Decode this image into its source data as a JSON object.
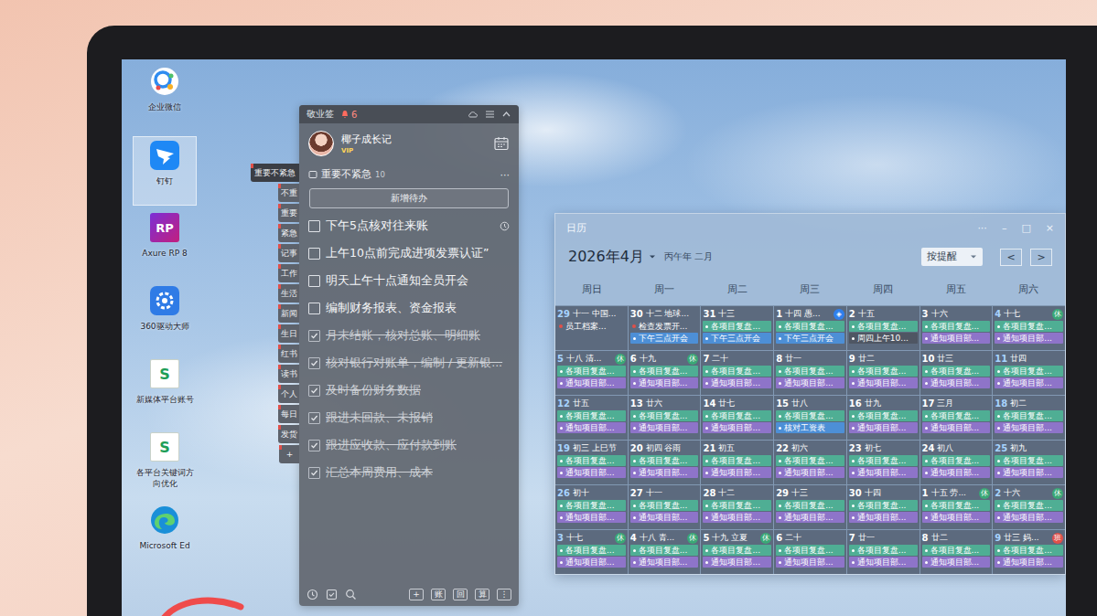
{
  "desktop": {
    "icons": [
      {
        "label": "企业微信",
        "kind": "wecom",
        "selected": false
      },
      {
        "label": "钉钉",
        "kind": "dingtalk",
        "selected": true
      },
      {
        "label": "Axure RP 8",
        "kind": "axure",
        "glyph": "RP",
        "selected": false
      },
      {
        "label": "360驱动大师",
        "kind": "driver",
        "selected": false
      },
      {
        "label": "新媒体平台账号",
        "kind": "sheet",
        "glyph": "S",
        "selected": false
      },
      {
        "label": "各平台关键词方向优化",
        "kind": "sheet",
        "glyph": "S",
        "selected": false
      },
      {
        "label": "Microsoft Ed",
        "kind": "edge",
        "selected": false
      }
    ]
  },
  "notes_app": {
    "title": "敬业签",
    "alert_count": "6",
    "user": {
      "name": "椰子成长记",
      "badge": "VIP"
    },
    "category": {
      "name": "重要不紧急",
      "count": "10",
      "more": "···"
    },
    "add_button": "新增待办",
    "todos": [
      {
        "text": "下午5点核对往来账",
        "checked": false,
        "reminder": true
      },
      {
        "text": "上午10点前完成进项发票认证”",
        "checked": false,
        "reminder": false
      },
      {
        "text": "明天上午十点通知全员开会",
        "checked": false,
        "reminder": false
      },
      {
        "text": "编制财务报表、资金报表",
        "checked": false,
        "reminder": false
      },
      {
        "text": "月末结账，核对总账、明细账",
        "checked": true,
        "reminder": false
      },
      {
        "text": "核对银行对账单，编制 / 更新银...",
        "checked": true,
        "reminder": false
      },
      {
        "text": "及时备份财务数据",
        "checked": true,
        "reminder": false
      },
      {
        "text": "跟进未回款、未报销",
        "checked": true,
        "reminder": false
      },
      {
        "text": "跟进应收款、应付款到账",
        "checked": true,
        "reminder": false
      },
      {
        "text": "汇总本周费用、成本",
        "checked": true,
        "reminder": false
      }
    ],
    "toolbar": [
      "+",
      "账",
      "回",
      "算",
      "⋮"
    ],
    "side_tabs": [
      {
        "label": "重要不紧急",
        "selected": true
      },
      {
        "label": "不重",
        "selected": false
      },
      {
        "label": "重要",
        "selected": false
      },
      {
        "label": "紧急",
        "selected": false
      },
      {
        "label": "记事",
        "selected": false
      },
      {
        "label": "工作",
        "selected": false
      },
      {
        "label": "生活",
        "selected": false
      },
      {
        "label": "新闻",
        "selected": false
      },
      {
        "label": "生日",
        "selected": false
      },
      {
        "label": "红书",
        "selected": false
      },
      {
        "label": "读书",
        "selected": false
      },
      {
        "label": "个人",
        "selected": false
      },
      {
        "label": "每日",
        "selected": false
      },
      {
        "label": "发货",
        "selected": false
      },
      {
        "label": "+",
        "selected": false
      }
    ]
  },
  "calendar": {
    "title": "日历",
    "controls": [
      "···",
      "–",
      "□",
      "×"
    ],
    "month": "2026年4月",
    "lunar_year": "丙午年 二月",
    "filter": "按提醒",
    "prev": "<",
    "next": ">",
    "weekdays": [
      "周日",
      "周一",
      "周二",
      "周三",
      "周四",
      "周五",
      "周六"
    ],
    "weeks": [
      [
        {
          "day": "29",
          "lunar": "十一 中国...",
          "events": [
            {
              "text": "员工档案...",
              "color": "#e0504a",
              "kind": "dot"
            }
          ]
        },
        {
          "day": "30",
          "lunar": "十二 地球...",
          "events": [
            {
              "text": "检查发票开...",
              "color": "#e0504a",
              "kind": "dot"
            },
            {
              "text": "下午三点开会",
              "color": "#4d8fd6",
              "kind": "bar"
            }
          ]
        },
        {
          "day": "31",
          "lunar": "十三",
          "events": [
            {
              "text": "各项目复盘...",
              "color": "#4fae94",
              "kind": "bar"
            },
            {
              "text": "下午三点开会",
              "color": "#4d8fd6",
              "kind": "bar"
            }
          ]
        },
        {
          "day": "1",
          "lunar": "十四 愚...",
          "badge": "◈",
          "badge_color": "#2f80ed",
          "events": [
            {
              "text": "各项目复盘...",
              "color": "#4fae94",
              "kind": "bar"
            },
            {
              "text": "下午三点开会",
              "color": "#4d8fd6",
              "kind": "bar"
            }
          ]
        },
        {
          "day": "2",
          "lunar": "十五",
          "events": [
            {
              "text": "各项目复盘...",
              "color": "#4fae94",
              "kind": "bar"
            },
            {
              "text": "周四上午10...",
              "color": "#4f5663",
              "kind": "bar"
            }
          ]
        },
        {
          "day": "3",
          "lunar": "十六",
          "events": [
            {
              "text": "各项目复盘...",
              "color": "#4fae94",
              "kind": "bar"
            },
            {
              "text": "通知项目部...",
              "color": "#8e74c9",
              "kind": "bar"
            }
          ]
        },
        {
          "day": "4",
          "lunar": "十七",
          "badge": "休",
          "badge_color": "#3aa876",
          "events": [
            {
              "text": "各项目复盘...",
              "color": "#4fae94",
              "kind": "bar"
            },
            {
              "text": "通知项目部...",
              "color": "#8e74c9",
              "kind": "bar"
            }
          ]
        }
      ],
      [
        {
          "day": "5",
          "lunar": "十八 清...",
          "badge": "休",
          "badge_color": "#3aa876",
          "events": [
            {
              "text": "各项目复盘...",
              "color": "#4fae94",
              "kind": "bar"
            },
            {
              "text": "通知项目部...",
              "color": "#8e74c9",
              "kind": "bar"
            }
          ]
        },
        {
          "day": "6",
          "lunar": "十九",
          "badge": "休",
          "badge_color": "#3aa876",
          "events": [
            {
              "text": "各项目复盘...",
              "color": "#4fae94",
              "kind": "bar"
            },
            {
              "text": "通知项目部...",
              "color": "#8e74c9",
              "kind": "bar"
            }
          ]
        },
        {
          "day": "7",
          "lunar": "二十",
          "events": [
            {
              "text": "各项目复盘...",
              "color": "#4fae94",
              "kind": "bar"
            },
            {
              "text": "通知项目部...",
              "color": "#8e74c9",
              "kind": "bar"
            }
          ]
        },
        {
          "day": "8",
          "lunar": "廿一",
          "events": [
            {
              "text": "各项目复盘...",
              "color": "#4fae94",
              "kind": "bar"
            },
            {
              "text": "通知项目部...",
              "color": "#8e74c9",
              "kind": "bar"
            }
          ]
        },
        {
          "day": "9",
          "lunar": "廿二",
          "events": [
            {
              "text": "各项目复盘...",
              "color": "#4fae94",
              "kind": "bar"
            },
            {
              "text": "通知项目部...",
              "color": "#8e74c9",
              "kind": "bar"
            }
          ]
        },
        {
          "day": "10",
          "lunar": "廿三",
          "events": [
            {
              "text": "各项目复盘...",
              "color": "#4fae94",
              "kind": "bar"
            },
            {
              "text": "通知项目部...",
              "color": "#8e74c9",
              "kind": "bar"
            }
          ]
        },
        {
          "day": "11",
          "lunar": "廿四",
          "events": [
            {
              "text": "各项目复盘...",
              "color": "#4fae94",
              "kind": "bar"
            },
            {
              "text": "通知项目部...",
              "color": "#8e74c9",
              "kind": "bar"
            }
          ]
        }
      ],
      [
        {
          "day": "12",
          "lunar": "廿五",
          "events": [
            {
              "text": "各项目复盘...",
              "color": "#4fae94",
              "kind": "bar"
            },
            {
              "text": "通知项目部...",
              "color": "#8e74c9",
              "kind": "bar"
            }
          ]
        },
        {
          "day": "13",
          "lunar": "廿六",
          "events": [
            {
              "text": "各项目复盘...",
              "color": "#4fae94",
              "kind": "bar"
            },
            {
              "text": "通知项目部...",
              "color": "#8e74c9",
              "kind": "bar"
            }
          ]
        },
        {
          "day": "14",
          "lunar": "廿七",
          "events": [
            {
              "text": "各项目复盘...",
              "color": "#4fae94",
              "kind": "bar"
            },
            {
              "text": "通知项目部...",
              "color": "#8e74c9",
              "kind": "bar"
            }
          ]
        },
        {
          "day": "15",
          "lunar": "廿八",
          "events": [
            {
              "text": "各项目复盘...",
              "color": "#4fae94",
              "kind": "bar"
            },
            {
              "text": "核对工资表",
              "color": "#4d8fd6",
              "kind": "bar"
            }
          ]
        },
        {
          "day": "16",
          "lunar": "廿九",
          "events": [
            {
              "text": "各项目复盘...",
              "color": "#4fae94",
              "kind": "bar"
            },
            {
              "text": "通知项目部...",
              "color": "#8e74c9",
              "kind": "bar"
            }
          ]
        },
        {
          "day": "17",
          "lunar": "三月",
          "events": [
            {
              "text": "各项目复盘...",
              "color": "#4fae94",
              "kind": "bar"
            },
            {
              "text": "通知项目部...",
              "color": "#8e74c9",
              "kind": "bar"
            }
          ]
        },
        {
          "day": "18",
          "lunar": "初二",
          "events": [
            {
              "text": "各项目复盘...",
              "color": "#4fae94",
              "kind": "bar"
            },
            {
              "text": "通知项目部...",
              "color": "#8e74c9",
              "kind": "bar"
            }
          ]
        }
      ],
      [
        {
          "day": "19",
          "lunar": "初三 上巳节",
          "events": [
            {
              "text": "各项目复盘...",
              "color": "#4fae94",
              "kind": "bar"
            },
            {
              "text": "通知项目部...",
              "color": "#8e74c9",
              "kind": "bar"
            }
          ]
        },
        {
          "day": "20",
          "lunar": "初四 谷雨",
          "events": [
            {
              "text": "各项目复盘...",
              "color": "#4fae94",
              "kind": "bar"
            },
            {
              "text": "通知项目部...",
              "color": "#8e74c9",
              "kind": "bar"
            }
          ]
        },
        {
          "day": "21",
          "lunar": "初五",
          "events": [
            {
              "text": "各项目复盘...",
              "color": "#4fae94",
              "kind": "bar"
            },
            {
              "text": "通知项目部...",
              "color": "#8e74c9",
              "kind": "bar"
            }
          ]
        },
        {
          "day": "22",
          "lunar": "初六",
          "events": [
            {
              "text": "各项目复盘...",
              "color": "#4fae94",
              "kind": "bar"
            },
            {
              "text": "通知项目部...",
              "color": "#8e74c9",
              "kind": "bar"
            }
          ]
        },
        {
          "day": "23",
          "lunar": "初七",
          "events": [
            {
              "text": "各项目复盘...",
              "color": "#4fae94",
              "kind": "bar"
            },
            {
              "text": "通知项目部...",
              "color": "#8e74c9",
              "kind": "bar"
            }
          ]
        },
        {
          "day": "24",
          "lunar": "初八",
          "events": [
            {
              "text": "各项目复盘...",
              "color": "#4fae94",
              "kind": "bar"
            },
            {
              "text": "通知项目部...",
              "color": "#8e74c9",
              "kind": "bar"
            }
          ]
        },
        {
          "day": "25",
          "lunar": "初九",
          "events": [
            {
              "text": "各项目复盘...",
              "color": "#4fae94",
              "kind": "bar"
            },
            {
              "text": "通知项目部...",
              "color": "#8e74c9",
              "kind": "bar"
            }
          ]
        }
      ],
      [
        {
          "day": "26",
          "lunar": "初十",
          "events": [
            {
              "text": "各项目复盘...",
              "color": "#4fae94",
              "kind": "bar"
            },
            {
              "text": "通知项目部...",
              "color": "#8e74c9",
              "kind": "bar"
            }
          ]
        },
        {
          "day": "27",
          "lunar": "十一",
          "events": [
            {
              "text": "各项目复盘...",
              "color": "#4fae94",
              "kind": "bar"
            },
            {
              "text": "通知项目部...",
              "color": "#8e74c9",
              "kind": "bar"
            }
          ]
        },
        {
          "day": "28",
          "lunar": "十二",
          "events": [
            {
              "text": "各项目复盘...",
              "color": "#4fae94",
              "kind": "bar"
            },
            {
              "text": "通知项目部...",
              "color": "#8e74c9",
              "kind": "bar"
            }
          ]
        },
        {
          "day": "29",
          "lunar": "十三",
          "events": [
            {
              "text": "各项目复盘...",
              "color": "#4fae94",
              "kind": "bar"
            },
            {
              "text": "通知项目部...",
              "color": "#8e74c9",
              "kind": "bar"
            }
          ]
        },
        {
          "day": "30",
          "lunar": "十四",
          "events": [
            {
              "text": "各项目复盘...",
              "color": "#4fae94",
              "kind": "bar"
            },
            {
              "text": "通知项目部...",
              "color": "#8e74c9",
              "kind": "bar"
            }
          ]
        },
        {
          "day": "1",
          "lunar": "十五 劳...",
          "badge": "休",
          "badge_color": "#3aa876",
          "events": [
            {
              "text": "各项目复盘...",
              "color": "#4fae94",
              "kind": "bar"
            },
            {
              "text": "通知项目部...",
              "color": "#8e74c9",
              "kind": "bar"
            }
          ]
        },
        {
          "day": "2",
          "lunar": "十六",
          "badge": "休",
          "badge_color": "#3aa876",
          "events": [
            {
              "text": "各项目复盘...",
              "color": "#4fae94",
              "kind": "bar"
            },
            {
              "text": "通知项目部...",
              "color": "#8e74c9",
              "kind": "bar"
            }
          ]
        }
      ],
      [
        {
          "day": "3",
          "lunar": "十七",
          "badge": "休",
          "badge_color": "#3aa876",
          "events": [
            {
              "text": "各项目复盘...",
              "color": "#4fae94",
              "kind": "bar"
            },
            {
              "text": "通知项目部...",
              "color": "#8e74c9",
              "kind": "bar"
            }
          ]
        },
        {
          "day": "4",
          "lunar": "十八 青...",
          "badge": "休",
          "badge_color": "#3aa876",
          "events": [
            {
              "text": "各项目复盘...",
              "color": "#4fae94",
              "kind": "bar"
            },
            {
              "text": "通知项目部...",
              "color": "#8e74c9",
              "kind": "bar"
            }
          ]
        },
        {
          "day": "5",
          "lunar": "十九 立夏",
          "badge": "休",
          "badge_color": "#3aa876",
          "events": [
            {
              "text": "各项目复盘...",
              "color": "#4fae94",
              "kind": "bar"
            },
            {
              "text": "通知项目部...",
              "color": "#8e74c9",
              "kind": "bar"
            }
          ]
        },
        {
          "day": "6",
          "lunar": "二十",
          "events": [
            {
              "text": "各项目复盘...",
              "color": "#4fae94",
              "kind": "bar"
            },
            {
              "text": "通知项目部...",
              "color": "#8e74c9",
              "kind": "bar"
            }
          ]
        },
        {
          "day": "7",
          "lunar": "廿一",
          "events": [
            {
              "text": "各项目复盘...",
              "color": "#4fae94",
              "kind": "bar"
            },
            {
              "text": "通知项目部...",
              "color": "#8e74c9",
              "kind": "bar"
            }
          ]
        },
        {
          "day": "8",
          "lunar": "廿二",
          "events": [
            {
              "text": "各项目复盘...",
              "color": "#4fae94",
              "kind": "bar"
            },
            {
              "text": "通知项目部...",
              "color": "#8e74c9",
              "kind": "bar"
            }
          ]
        },
        {
          "day": "9",
          "lunar": "廿三 妈...",
          "badge": "班",
          "badge_color": "#e0504a",
          "events": [
            {
              "text": "各项目复盘...",
              "color": "#4fae94",
              "kind": "bar"
            },
            {
              "text": "通知项目部...",
              "color": "#8e74c9",
              "kind": "bar"
            }
          ]
        }
      ]
    ]
  }
}
